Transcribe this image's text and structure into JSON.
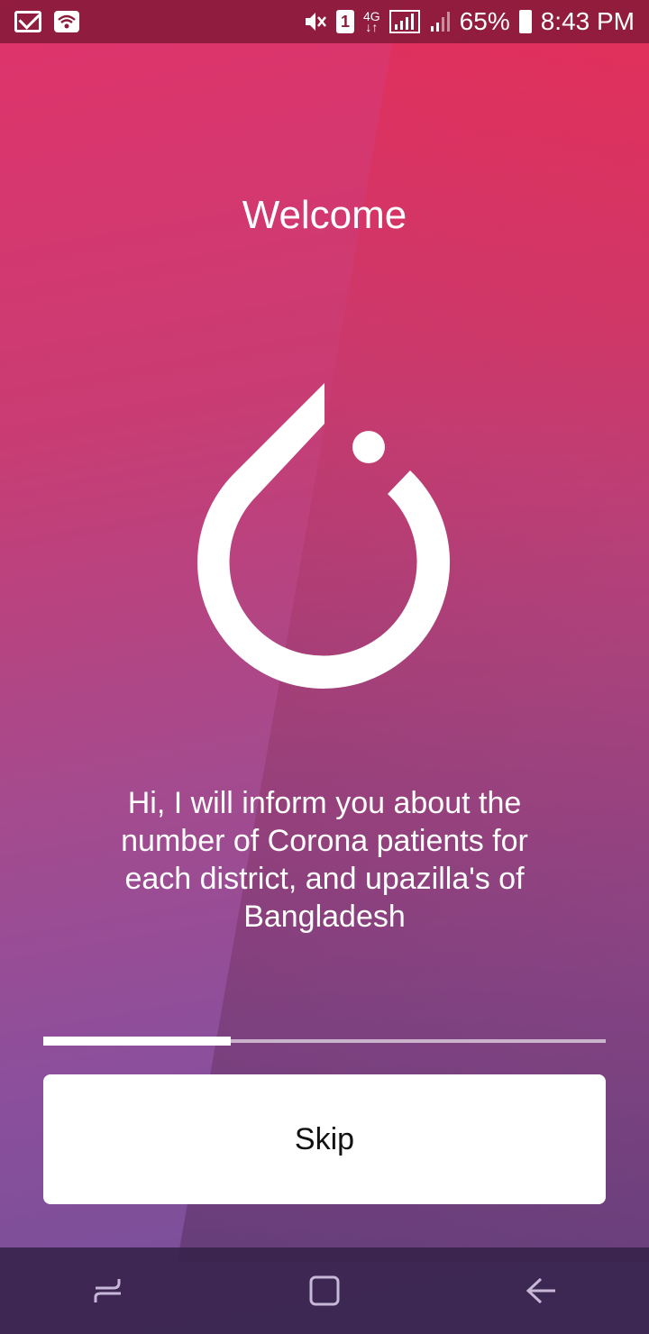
{
  "status_bar": {
    "battery": "65%",
    "time": "8:43 PM",
    "sim_slot": "1",
    "network": "4G",
    "icons_left": [
      "gmail-icon",
      "wifi-icon"
    ],
    "icons_right": [
      "mute-icon",
      "sim-icon",
      "network-4g-icon",
      "signal-icon",
      "signal-icon-2",
      "battery-icon"
    ]
  },
  "main": {
    "title": "Welcome",
    "logo_icon": "pytorch-flame-icon",
    "message": "Hi, I will inform you about the number of Corona patients for each district, and upazilla's of Bangladesh",
    "progress": 0.333,
    "skip_label": "Skip"
  },
  "nav_bar": {
    "items": [
      "recents-icon",
      "home-icon",
      "back-icon"
    ]
  },
  "colors": {
    "gradient_top": "#e0336a",
    "gradient_bottom": "#6f4f98",
    "button_bg": "#ffffff",
    "text": "#ffffff"
  }
}
